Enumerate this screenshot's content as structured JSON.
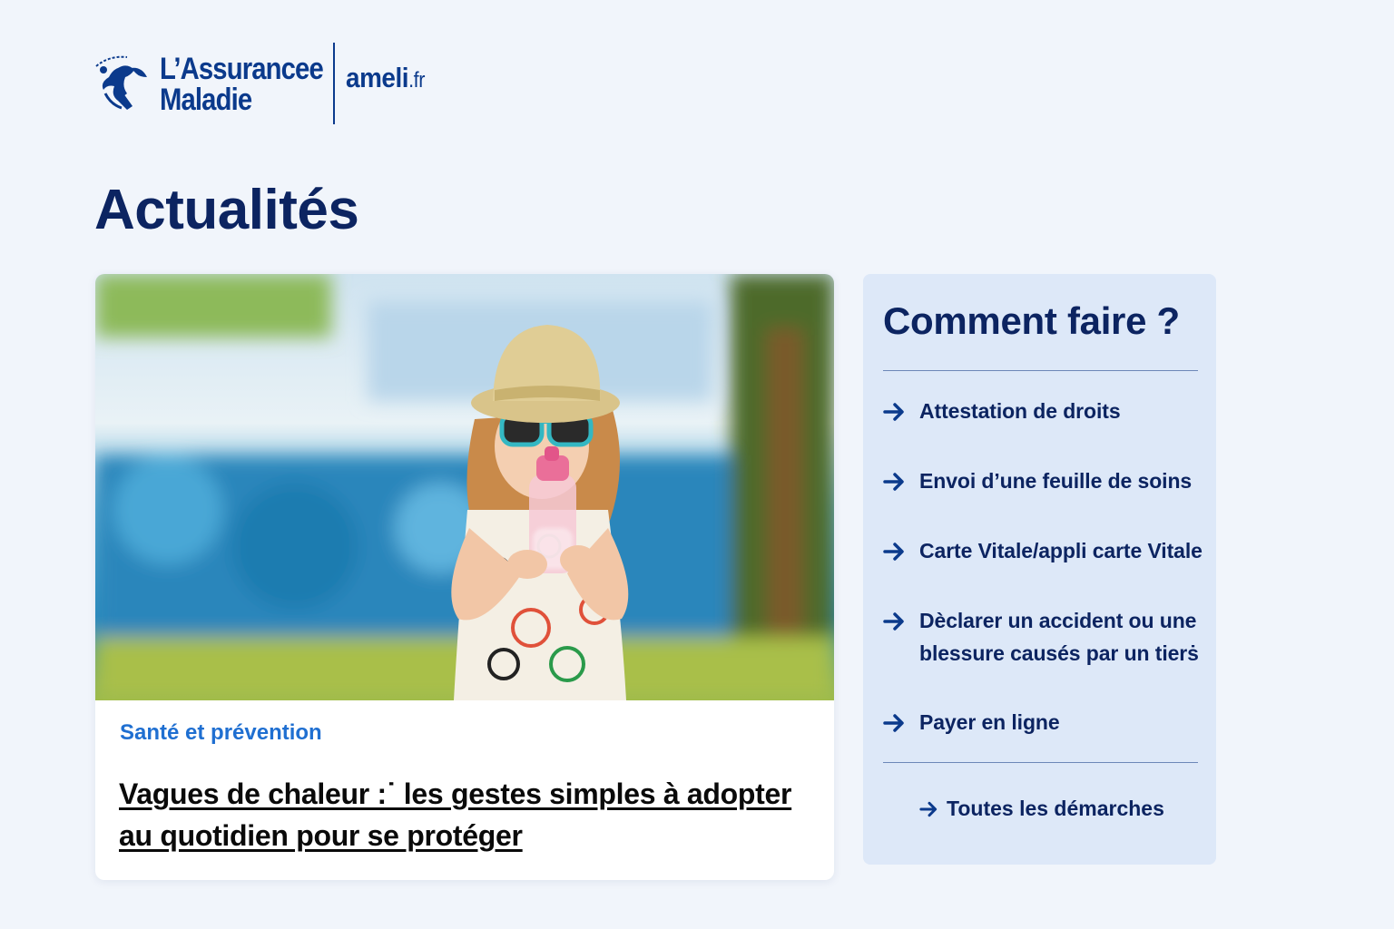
{
  "header": {
    "logo_line1": "L’Assurancee",
    "logo_line2": "Maladie",
    "site_name": "ameli",
    "site_tld": ".fr",
    "brand_color": "#0b3a8c"
  },
  "page": {
    "title": "Actualités"
  },
  "news": {
    "image_alt": "Fillette avec chapeau et lunettes de soleil buvant dans une gourde",
    "category": "Santé et prévention",
    "title": "Vagues de chaleur :˙ les gestes simples à adopter au quotidien pour se protéger",
    "category_color": "#1f6fd1"
  },
  "side_panel": {
    "title": "Comment faire ?",
    "links": [
      {
        "label": "Attestation de droits"
      },
      {
        "label": "Envoi d’une feuille de soins"
      },
      {
        "label": "Carte Vitale/appli carte Vitale"
      },
      {
        "label": "Dèclarer un accident ou une blessure causés par un tierṡ"
      },
      {
        "label": "Payer en ligne"
      }
    ],
    "all_link": "Toutes les démarches",
    "background": "#dde8f8"
  }
}
